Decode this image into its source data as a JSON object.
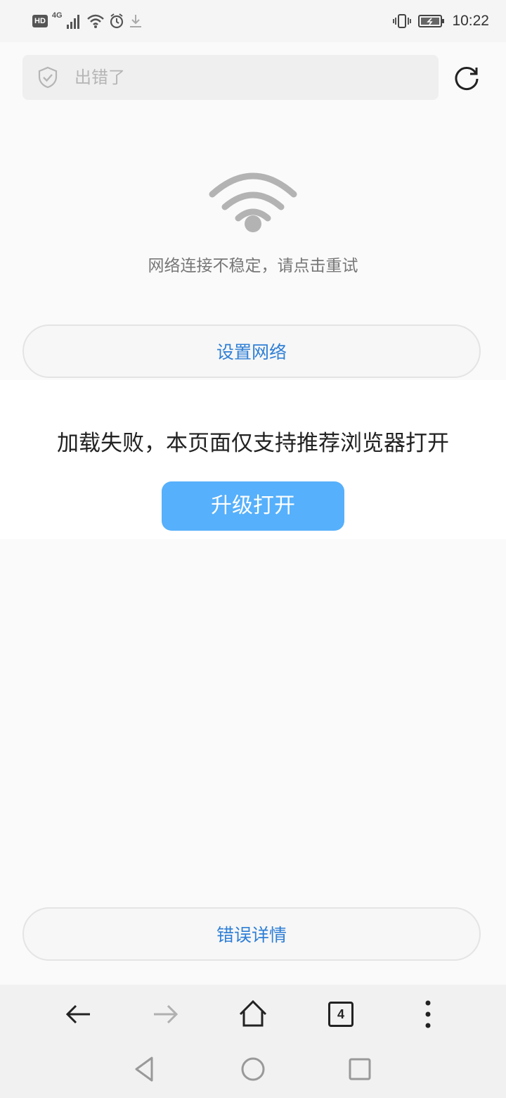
{
  "status_bar": {
    "hd_label": "HD",
    "network_label": "4G",
    "time": "10:22"
  },
  "address_bar": {
    "text": "出错了",
    "shield_icon": "shield-check-icon",
    "reload_icon": "reload-icon"
  },
  "error": {
    "wifi_icon": "wifi-icon",
    "message": "网络连接不稳定，请点击重试",
    "settings_button": "设置网络"
  },
  "banner": {
    "text": "加载失败，本页面仅支持推荐浏览器打开",
    "upgrade_button": "升级打开"
  },
  "details_button": "错误详情",
  "toolbar": {
    "tab_count": "4"
  },
  "colors": {
    "accent": "#56b0fb",
    "link": "#2f7fd6"
  }
}
